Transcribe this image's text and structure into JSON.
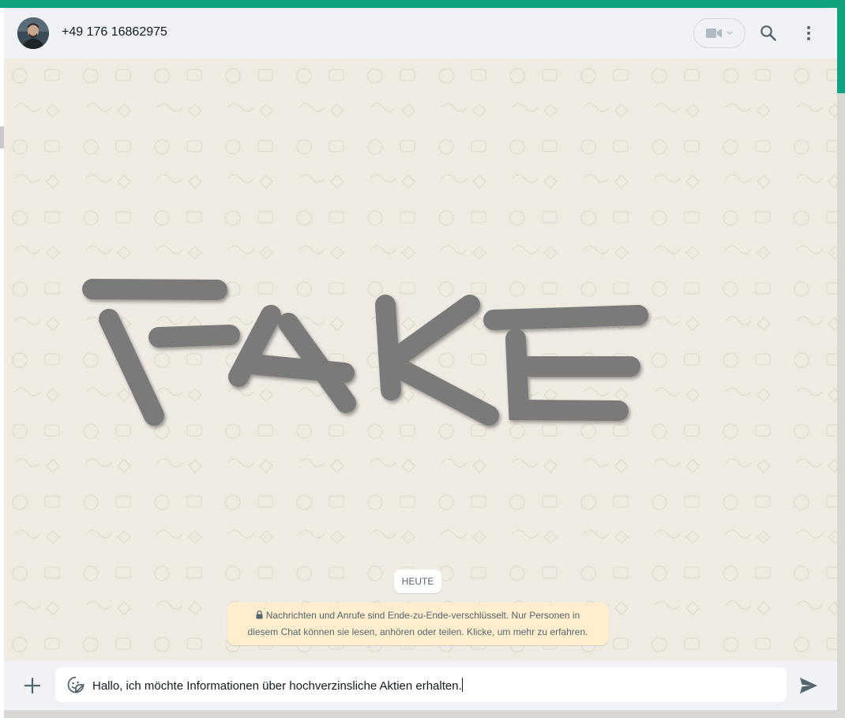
{
  "header": {
    "contact_name": "+49 176 16862975",
    "avatar_icon": "contact-avatar",
    "video_call_icon": "video-camera-icon",
    "search_icon": "search-icon",
    "menu_icon": "more-vertical-icon"
  },
  "conversation": {
    "overlay_text": "FAKE",
    "date_chip": "HEUTE",
    "encryption_notice_line1": "Nachrichten und Anrufe sind Ende-zu-Ende-verschlüsselt. Nur Personen in",
    "encryption_notice_line2": "diesem Chat können sie lesen, anhören oder teilen. Klicke, um mehr zu erfahren."
  },
  "composer": {
    "attach_icon": "plus-icon",
    "sticker_icon": "sticker-icon",
    "message_value": "Hallo, ich möchte Informationen über hochverzinsliche Aktien erhalten.",
    "send_icon": "send-icon"
  },
  "colors": {
    "accent": "#0fa37f",
    "header_bg": "#f0f2f5",
    "chat_bg": "#efeae2",
    "notice_bg": "#ffeecd",
    "overlay_stroke": "#7a7a7a"
  }
}
